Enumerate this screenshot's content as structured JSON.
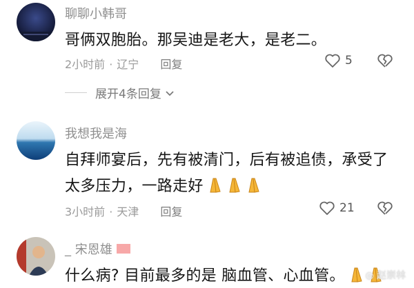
{
  "comments": [
    {
      "username": "聊聊小韩哥",
      "text_lines": [
        "哥俩双胞胎。那吴迪是老大，是老二。"
      ],
      "time": "2小时前",
      "location": "辽宁",
      "reply_label": "回复",
      "likes": "5"
    },
    {
      "username": "我想我是海",
      "text_lines": [
        "自拜师宴后，先有被清门，后有被追债，承受了",
        "太多压力，一路走好"
      ],
      "time": "3小时前",
      "location": "天津",
      "reply_label": "回复",
      "likes": "21"
    },
    {
      "username": "_ 宋恩雄",
      "text_lines": [
        "什么病? 目前最多的是 脑血管、心血管。"
      ],
      "time": "",
      "location": "",
      "reply_label": "",
      "likes": ""
    }
  ],
  "expand_replies": "展开4条回复",
  "watermark": "赵崇林",
  "colors": {
    "text": "#161616",
    "muted": "#9a9a9a",
    "username": "#8f8f8f"
  }
}
